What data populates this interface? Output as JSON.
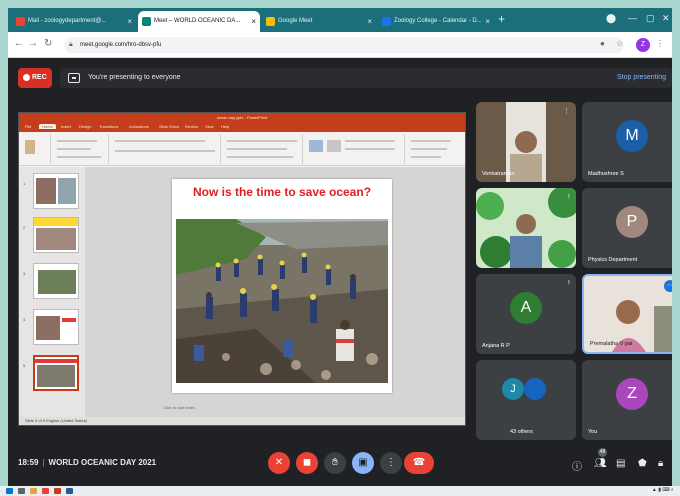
{
  "browser": {
    "tabs": [
      {
        "label": "Mail - zoologydepartment@...",
        "active": false,
        "icon_color": "#ea4335"
      },
      {
        "label": "Meet – WORLD OCEANIC DA...",
        "active": true,
        "icon_color": "#00897b"
      },
      {
        "label": "Google Meet",
        "active": false,
        "icon_color": "#fbbc04"
      },
      {
        "label": "Zoology College - Calendar - D...",
        "active": false,
        "icon_color": "#1a73e8"
      }
    ],
    "url": "meet.google.com/hro-dbsv-pfu",
    "profile_initial": "Z"
  },
  "meet": {
    "rec_label": "REC",
    "banner_text": "You're presenting to everyone",
    "stop_label": "Stop presenting"
  },
  "slide": {
    "app_title": "ocean day.pptx - PowerPoint",
    "ribbon_tabs": [
      "File",
      "Home",
      "Insert",
      "Design",
      "Transitions",
      "Animations",
      "Slide Show",
      "Review",
      "View",
      "Help"
    ],
    "title": "Now is the time to save ocean?",
    "notes_placeholder": "Click to add notes",
    "status": "Slide 5 of 5   English (United States)"
  },
  "participants": [
    {
      "name": "Venkatraman",
      "type": "video",
      "bg": "#6b5a48"
    },
    {
      "name": "Madhushree S",
      "type": "avatar",
      "initial": "M",
      "color": "#1a5fa8"
    },
    {
      "name": "",
      "type": "video",
      "bg": "#2e7d4f"
    },
    {
      "name": "Physics Department",
      "type": "avatar",
      "initial": "P",
      "color": "#a1887f"
    },
    {
      "name": "Anjana R P",
      "type": "avatar",
      "initial": "A",
      "color": "#2e7d32"
    },
    {
      "name": "Premalatha V pai",
      "type": "video",
      "bg": "#c9b9a8",
      "speaking": true
    },
    {
      "name": "43 others",
      "type": "group",
      "initial": "J",
      "color": "#1e88a8"
    },
    {
      "name": "You",
      "type": "avatar",
      "initial": "Z",
      "color": "#ab47bc"
    }
  ],
  "bottom": {
    "time": "18:59",
    "meeting_name": "WORLD OCEANIC DAY 2021",
    "people_count": "48"
  }
}
